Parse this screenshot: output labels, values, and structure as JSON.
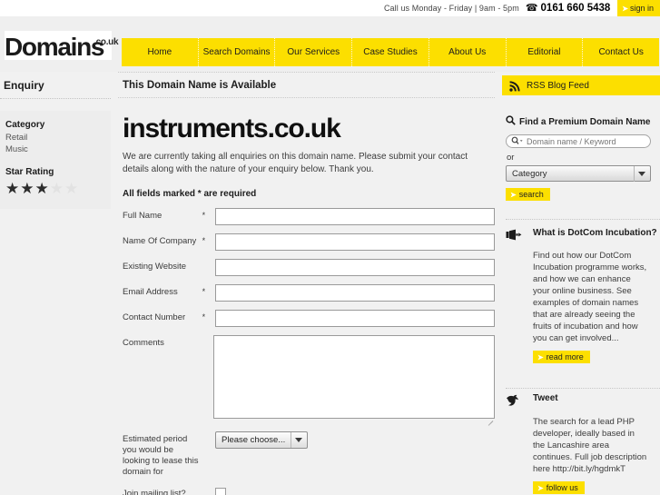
{
  "topbar": {
    "hours_text": "Call us Monday - Friday | 9am - 5pm",
    "phone_icon": "phone-icon",
    "phone_number": "0161 660 5438",
    "signin_label": "sign in",
    "chevron": "➤"
  },
  "logo": {
    "main": "Domains",
    "suffix": ".co.uk"
  },
  "nav": {
    "items": [
      {
        "label": "Home"
      },
      {
        "label": "Search Domains"
      },
      {
        "label": "Our Services"
      },
      {
        "label": "Case Studies"
      },
      {
        "label": "About Us"
      },
      {
        "label": "Editorial"
      },
      {
        "label": "Contact Us"
      }
    ]
  },
  "left_sidebar": {
    "title": "Enquiry",
    "category_heading": "Category",
    "categories": [
      "Retail",
      "Music"
    ],
    "star_heading": "Star Rating",
    "stars_filled": 3,
    "stars_total": 5
  },
  "main": {
    "page_heading": "This Domain Name is Available",
    "domain_title": "instruments.co.uk",
    "intro": "We are currently taking all enquiries on this domain name. Please submit your contact details along with the nature of your enquiry below. Thank you.",
    "required_note": "All fields marked * are required",
    "fields": [
      {
        "label": "Full Name",
        "required": "*",
        "value": "",
        "type": "text"
      },
      {
        "label": "Name Of Company",
        "required": "*",
        "value": "",
        "type": "text"
      },
      {
        "label": "Existing Website",
        "required": "",
        "value": "",
        "type": "text"
      },
      {
        "label": "Email Address",
        "required": "*",
        "value": "",
        "type": "text"
      },
      {
        "label": "Contact Number",
        "required": "*",
        "value": "",
        "type": "text"
      },
      {
        "label": "Comments",
        "required": "",
        "value": "",
        "type": "textarea"
      }
    ],
    "lease_label": "Estimated period you would be looking to lease this domain for",
    "lease_select_value": "Please choose...",
    "mailing_label": "Join mailing list?",
    "mailing_checked": false
  },
  "right_sidebar": {
    "rss_label": "RSS Blog Feed",
    "rss_icon": "rss-icon",
    "find_title": "Find a Premium Domain Name",
    "find_icon": "search-icon",
    "search_placeholder": "Domain name / Keyword",
    "search_value": "",
    "or_text": "or",
    "category_select_value": "Category",
    "search_button_label": "search",
    "promos": [
      {
        "icon": "megaphone-icon",
        "title": "What is DotCom Incubation?",
        "body": "Find out how our DotCom Incubation programme works, and how we can enhance your online business. See examples of domain names that are already seeing the fruits of incubation and how you can get involved...",
        "button_label": "read more"
      },
      {
        "icon": "twitter-bird-icon",
        "title": "Tweet",
        "body": "The search for a lead PHP developer, ideally based in the Lancashire area continues. Full job description here http://bit.ly/hgdmkT",
        "button_label": "follow us"
      }
    ]
  },
  "colors": {
    "brand_yellow": "#fcdf00",
    "page_bg": "#f1f1f1",
    "header_bg": "#efefef",
    "text_dark": "#1c1c1c"
  }
}
